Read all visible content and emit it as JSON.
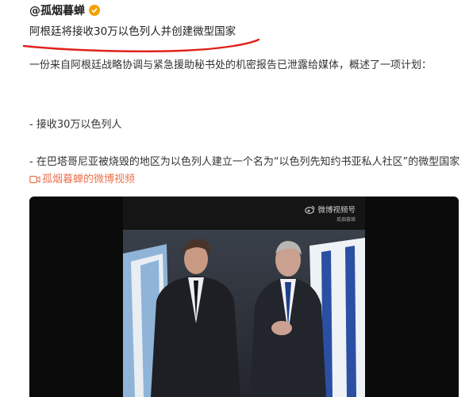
{
  "post": {
    "author": "@孤烟暮蝉",
    "headline": "阿根廷将接收30万以色列人并创建微型国家",
    "paragraph1": "一份来自阿根廷战略协调与紧急援助秘书处的机密报告已泄露给媒体，概述了一项计划：",
    "paragraph2": "- 接收30万以色列人",
    "paragraph3": "- 在巴塔哥尼亚被烧毁的地区为以色列人建立一个名为“以色列先知约书亚私人社区”的微型国家",
    "video_link": "孤烟暮蝉的微博视频"
  },
  "video": {
    "watermark": "微博视频号",
    "watermark_sub": "孤烟暮蝉"
  },
  "colors": {
    "link": "#eb7350",
    "badge": "#f4a200",
    "underline": "#e0211c"
  }
}
